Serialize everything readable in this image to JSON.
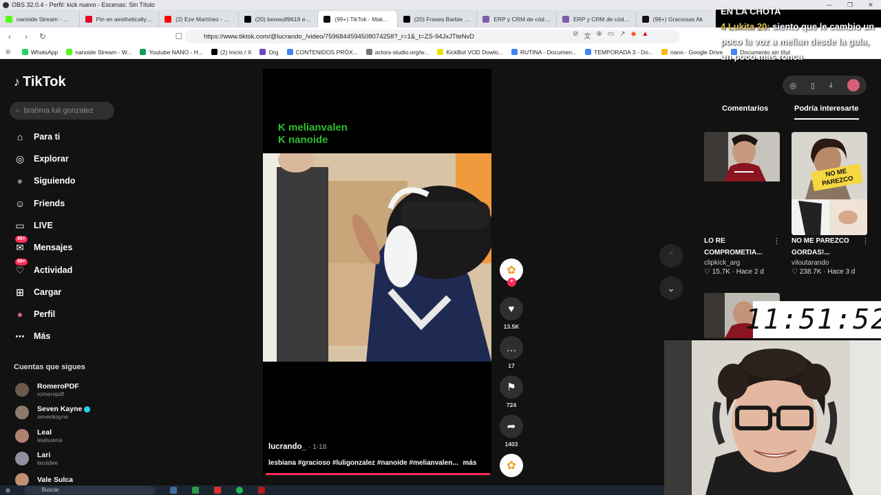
{
  "obs": {
    "title": "OBS 32.0.4 - Perfil: kick nuevo - Escenas: Sin Título",
    "controls": [
      "—",
      "❐",
      "✕"
    ]
  },
  "browser": {
    "tabs": [
      {
        "label": "nanoide Stream - Watch l",
        "color": "#53fc18"
      },
      {
        "label": "Pin en aesthetically pleasin",
        "color": "#e60023"
      },
      {
        "label": "(2) Eze Martínez - YouTube",
        "color": "#ff0000"
      },
      {
        "label": "(20) beowulf9619 en X: \"q",
        "color": "#000000"
      },
      {
        "label": "(99+) TikTok - Make Your D",
        "color": "#111111"
      },
      {
        "label": "(20) Frases Barbie en X: \"S",
        "color": "#000000"
      },
      {
        "label": "ERP y CRM de código abi",
        "color": "#7b5ea7"
      },
      {
        "label": "ERP y CRM de código abi",
        "color": "#7b5ea7"
      },
      {
        "label": "(99+) Graciosas Ak",
        "color": "#111111"
      }
    ],
    "url": "https://www.tiktok.com/@lucrando_/video/7596844594508074258?_r=1&_t=ZS-94JxJTteNvD",
    "bookmarks": [
      {
        "label": "WhatsApp",
        "color": "#25d366"
      },
      {
        "label": "nanoide Stream - W...",
        "color": "#53fc18"
      },
      {
        "label": "Youtube NANO - H...",
        "color": "#0f9d58"
      },
      {
        "label": "(2) Inicio / X",
        "color": "#000000"
      },
      {
        "label": "Org",
        "color": "#6b46c1"
      },
      {
        "label": "CONTENIDOS PRÓX...",
        "color": "#4285f4"
      },
      {
        "label": "actors-studio.org/w...",
        "color": "#777777"
      },
      {
        "label": "KickBot VOD Dowlo...",
        "color": "#e5e500"
      },
      {
        "label": "RUTINA - Documen...",
        "color": "#4285f4"
      },
      {
        "label": "TEMPORADA 3 - Do...",
        "color": "#4285f4"
      },
      {
        "label": "nano - Google Drive",
        "color": "#fbbc04"
      },
      {
        "label": "Documento sin títul",
        "color": "#4285f4"
      }
    ]
  },
  "tiktok": {
    "logo": "TikTok",
    "search_placeholder": "brahma luli gonzalez",
    "nav": [
      {
        "label": "Para ti",
        "icon": "home-icon",
        "glyph": "⌂"
      },
      {
        "label": "Explorar",
        "icon": "compass-icon",
        "glyph": "◎"
      },
      {
        "label": "Siguiendo",
        "icon": "avatar-icon",
        "glyph": "●"
      },
      {
        "label": "Friends",
        "icon": "friends-icon",
        "glyph": "☺"
      },
      {
        "label": "LIVE",
        "icon": "live-icon",
        "glyph": "▭"
      },
      {
        "label": "Mensajes",
        "icon": "messages-icon",
        "glyph": "✉",
        "badge": "99+"
      },
      {
        "label": "Actividad",
        "icon": "activity-icon",
        "glyph": "♡",
        "badge": "99+"
      },
      {
        "label": "Cargar",
        "icon": "upload-icon",
        "glyph": "⊞"
      },
      {
        "label": "Perfil",
        "icon": "profile-icon",
        "glyph": "●"
      },
      {
        "label": "Más",
        "icon": "more-icon",
        "glyph": "⋯"
      }
    ],
    "following_title": "Cuentas que sigues",
    "following": [
      {
        "name": "RomeroPDF",
        "handle": "romeropdf",
        "verified": false,
        "color": "#6a5a4a"
      },
      {
        "name": "Seven Kayne",
        "handle": "sevenkayne",
        "verified": true,
        "color": "#8a7a6a"
      },
      {
        "name": "Leal",
        "handle": "lealsuena",
        "verified": false,
        "color": "#b08070"
      },
      {
        "name": "Lari",
        "handle": "laroidee",
        "verified": false,
        "color": "#9090a0"
      },
      {
        "name": "Vale Sulca",
        "handle": "",
        "verified": false,
        "color": "#c09070"
      }
    ],
    "video": {
      "overlay_lines": [
        "K melianvalen",
        "K nanoide"
      ],
      "author": "lucrando_",
      "date": "· 1-18",
      "caption": "lesbiana #gracioso #luligonzalez #nanoide #melianvalen...",
      "more": "más",
      "progress": 1.0
    },
    "actions": [
      {
        "name": "like",
        "icon": "heart-icon",
        "glyph": "♥",
        "count": "13.5K"
      },
      {
        "name": "comment",
        "icon": "comment-icon",
        "glyph": "…",
        "count": "17"
      },
      {
        "name": "save",
        "icon": "bookmark-icon",
        "glyph": "⚑",
        "count": "724"
      },
      {
        "name": "share",
        "icon": "share-icon",
        "glyph": "➦",
        "count": "1403"
      }
    ],
    "right": {
      "tabs": [
        "Comentarios",
        "Podría interesarte"
      ],
      "active_tab": "Podría interesarte",
      "cards": [
        {
          "title_l1": "LO RE",
          "title_l2": "COMPROMETIA...",
          "user": "clipkick_arg",
          "likes": "15.7K",
          "time": "Hace 2 d"
        },
        {
          "title_l1": "NO ME PAREZCO",
          "title_l2": "GORDAS!...",
          "user": "viloutarando",
          "likes": "238.7K",
          "time": "Hace 3 d",
          "sticker": "NO ME PAREZCO"
        }
      ]
    }
  },
  "stream_overlay": {
    "chat_header": "EN LA CHOTA",
    "chat_user": "4 Lukita 20:",
    "chat_message": "siento que le cambio un poco la voz a melian desde la gula, un poco mas ronca",
    "clock": "11:51:52"
  },
  "taskbar": {
    "search": "Buscar"
  }
}
